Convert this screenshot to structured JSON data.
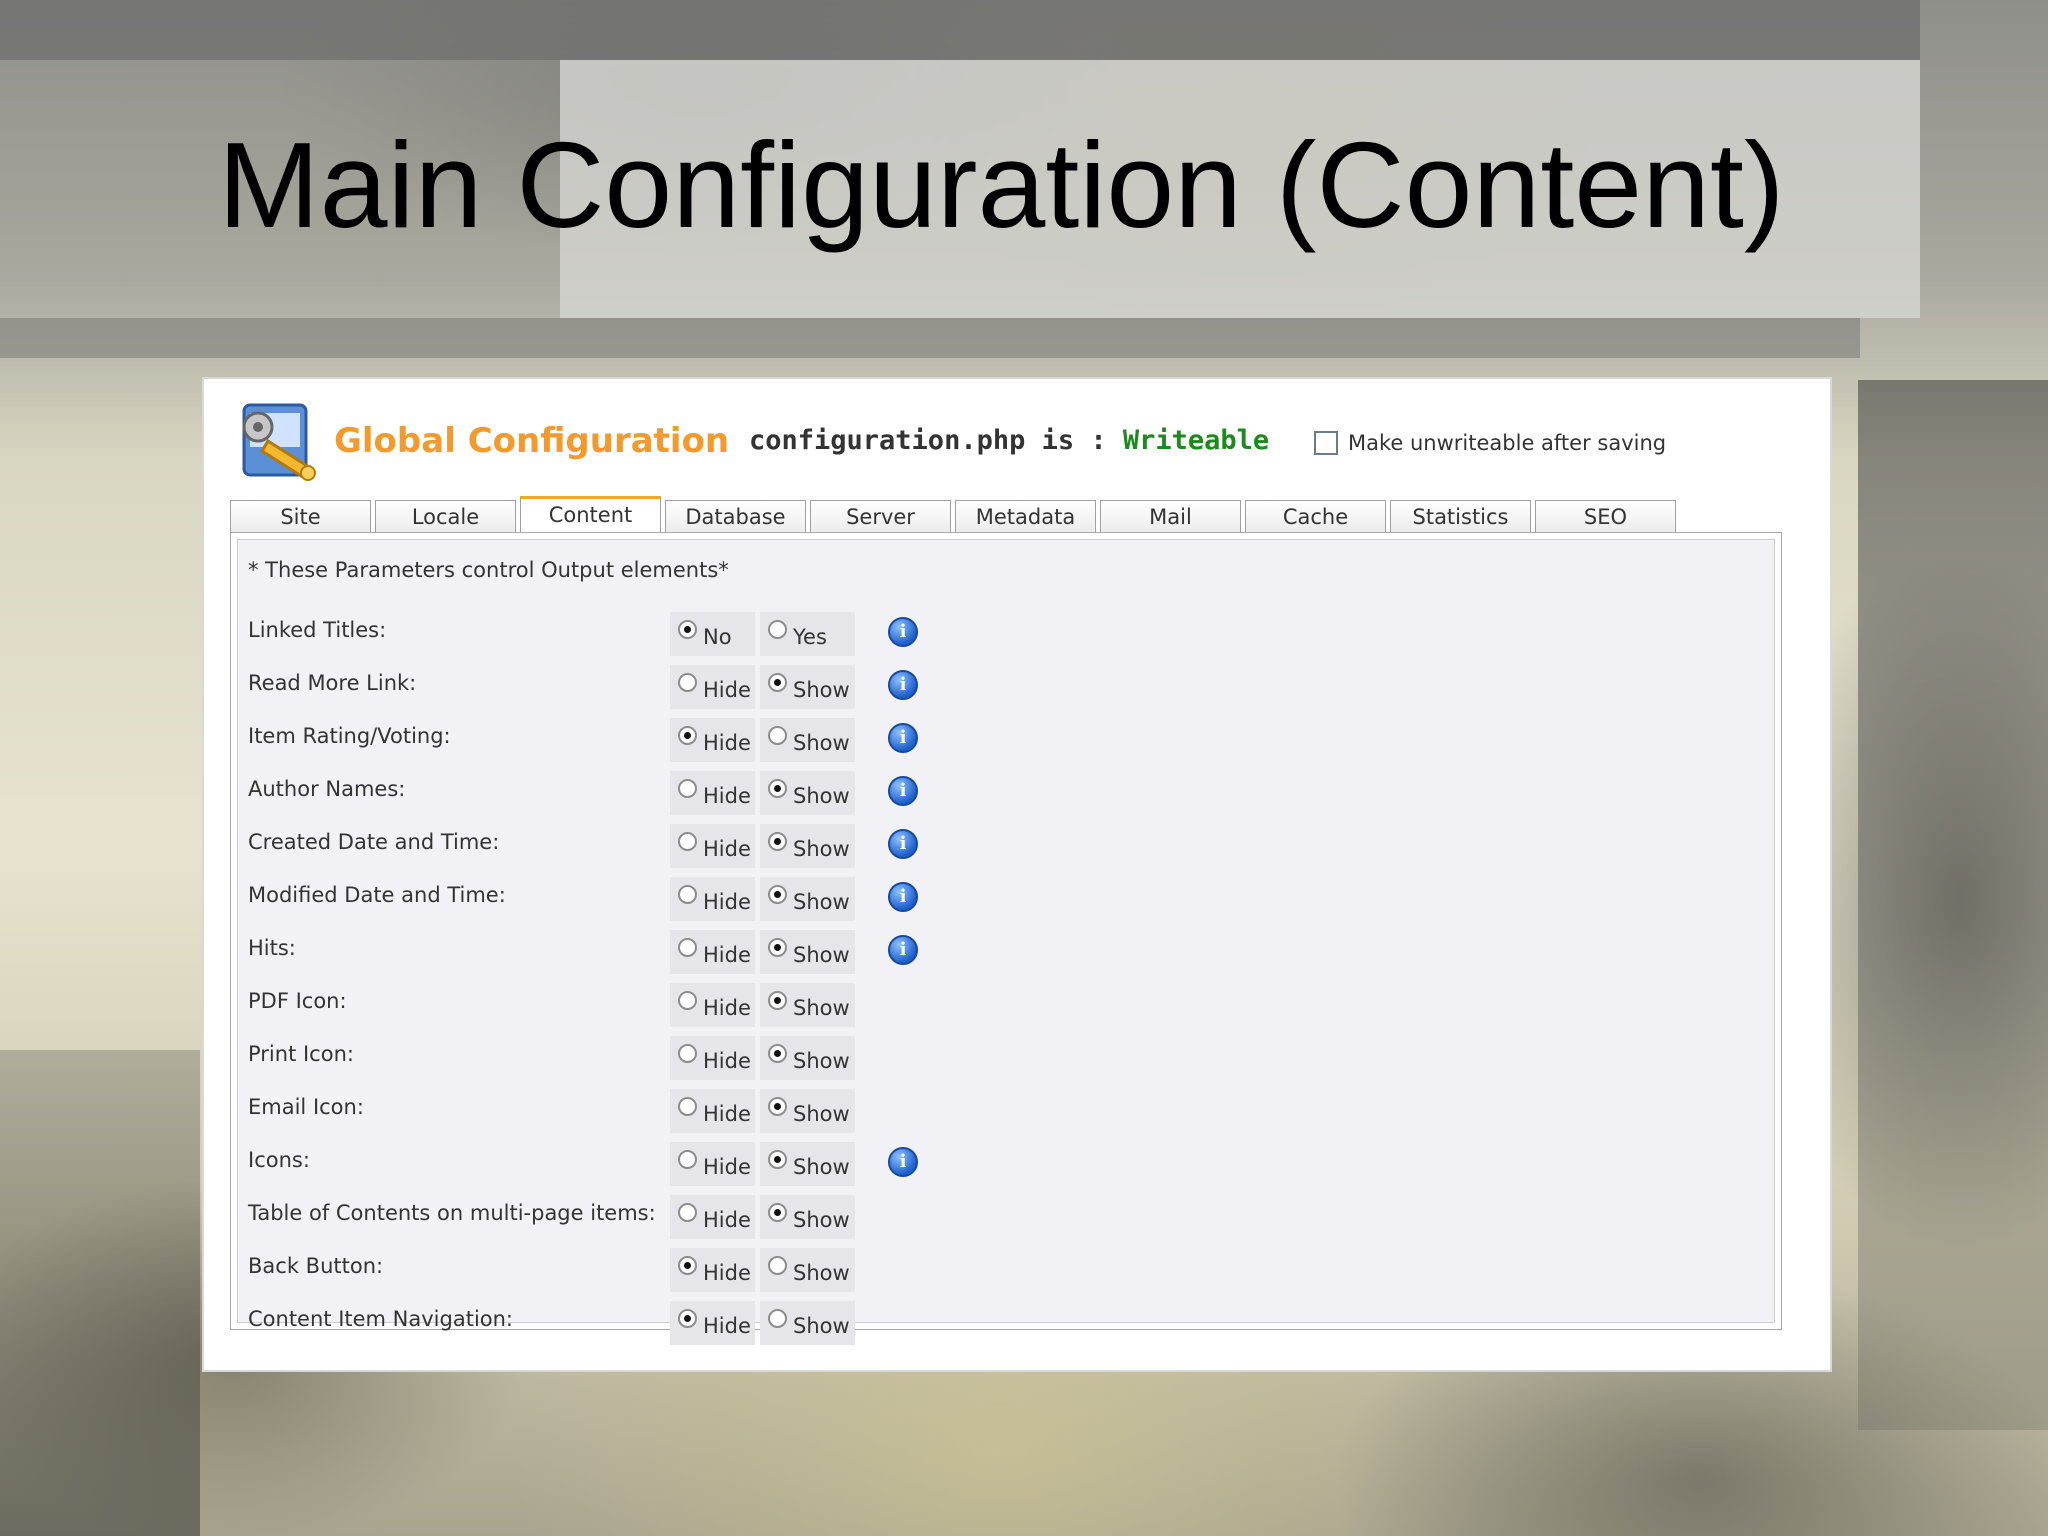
{
  "slide": {
    "title": "Main Configuration (Content)"
  },
  "panel": {
    "heading": "Global Configuration",
    "status_prefix": "configuration.php is : ",
    "status_value": "Writeable",
    "unwriteable_label": "Make unwriteable after saving",
    "unwriteable_checked": false,
    "status_color": "#1d8a1d",
    "heading_color": "#f29a2e"
  },
  "tabs": [
    "Site",
    "Locale",
    "Content",
    "Database",
    "Server",
    "Metadata",
    "Mail",
    "Cache",
    "Statistics",
    "SEO"
  ],
  "active_tab": "Content",
  "content": {
    "note": "* These Parameters control Output elements*",
    "rows": [
      {
        "label": "Linked Titles:",
        "opt1": "No",
        "opt2": "Yes",
        "selected": "No",
        "info": true
      },
      {
        "label": "Read More Link:",
        "opt1": "Hide",
        "opt2": "Show",
        "selected": "Show",
        "info": true
      },
      {
        "label": "Item Rating/Voting:",
        "opt1": "Hide",
        "opt2": "Show",
        "selected": "Hide",
        "info": true
      },
      {
        "label": "Author Names:",
        "opt1": "Hide",
        "opt2": "Show",
        "selected": "Show",
        "info": true
      },
      {
        "label": "Created Date and Time:",
        "opt1": "Hide",
        "opt2": "Show",
        "selected": "Show",
        "info": true
      },
      {
        "label": "Modified Date and Time:",
        "opt1": "Hide",
        "opt2": "Show",
        "selected": "Show",
        "info": true
      },
      {
        "label": "Hits:",
        "opt1": "Hide",
        "opt2": "Show",
        "selected": "Show",
        "info": true
      },
      {
        "label": "PDF Icon:",
        "opt1": "Hide",
        "opt2": "Show",
        "selected": "Show",
        "info": false
      },
      {
        "label": "Print Icon:",
        "opt1": "Hide",
        "opt2": "Show",
        "selected": "Show",
        "info": false
      },
      {
        "label": "Email Icon:",
        "opt1": "Hide",
        "opt2": "Show",
        "selected": "Show",
        "info": false
      },
      {
        "label": "Icons:",
        "opt1": "Hide",
        "opt2": "Show",
        "selected": "Show",
        "info": true
      },
      {
        "label": "Table of Contents on multi-page items:",
        "opt1": "Hide",
        "opt2": "Show",
        "selected": "Show",
        "info": false
      },
      {
        "label": "Back Button:",
        "opt1": "Hide",
        "opt2": "Show",
        "selected": "Hide",
        "info": false
      },
      {
        "label": "Content Item Navigation:",
        "opt1": "Hide",
        "opt2": "Show",
        "selected": "Hide",
        "info": false
      }
    ]
  },
  "icons": {
    "logo": "global-configuration-icon",
    "info": "info-icon"
  }
}
